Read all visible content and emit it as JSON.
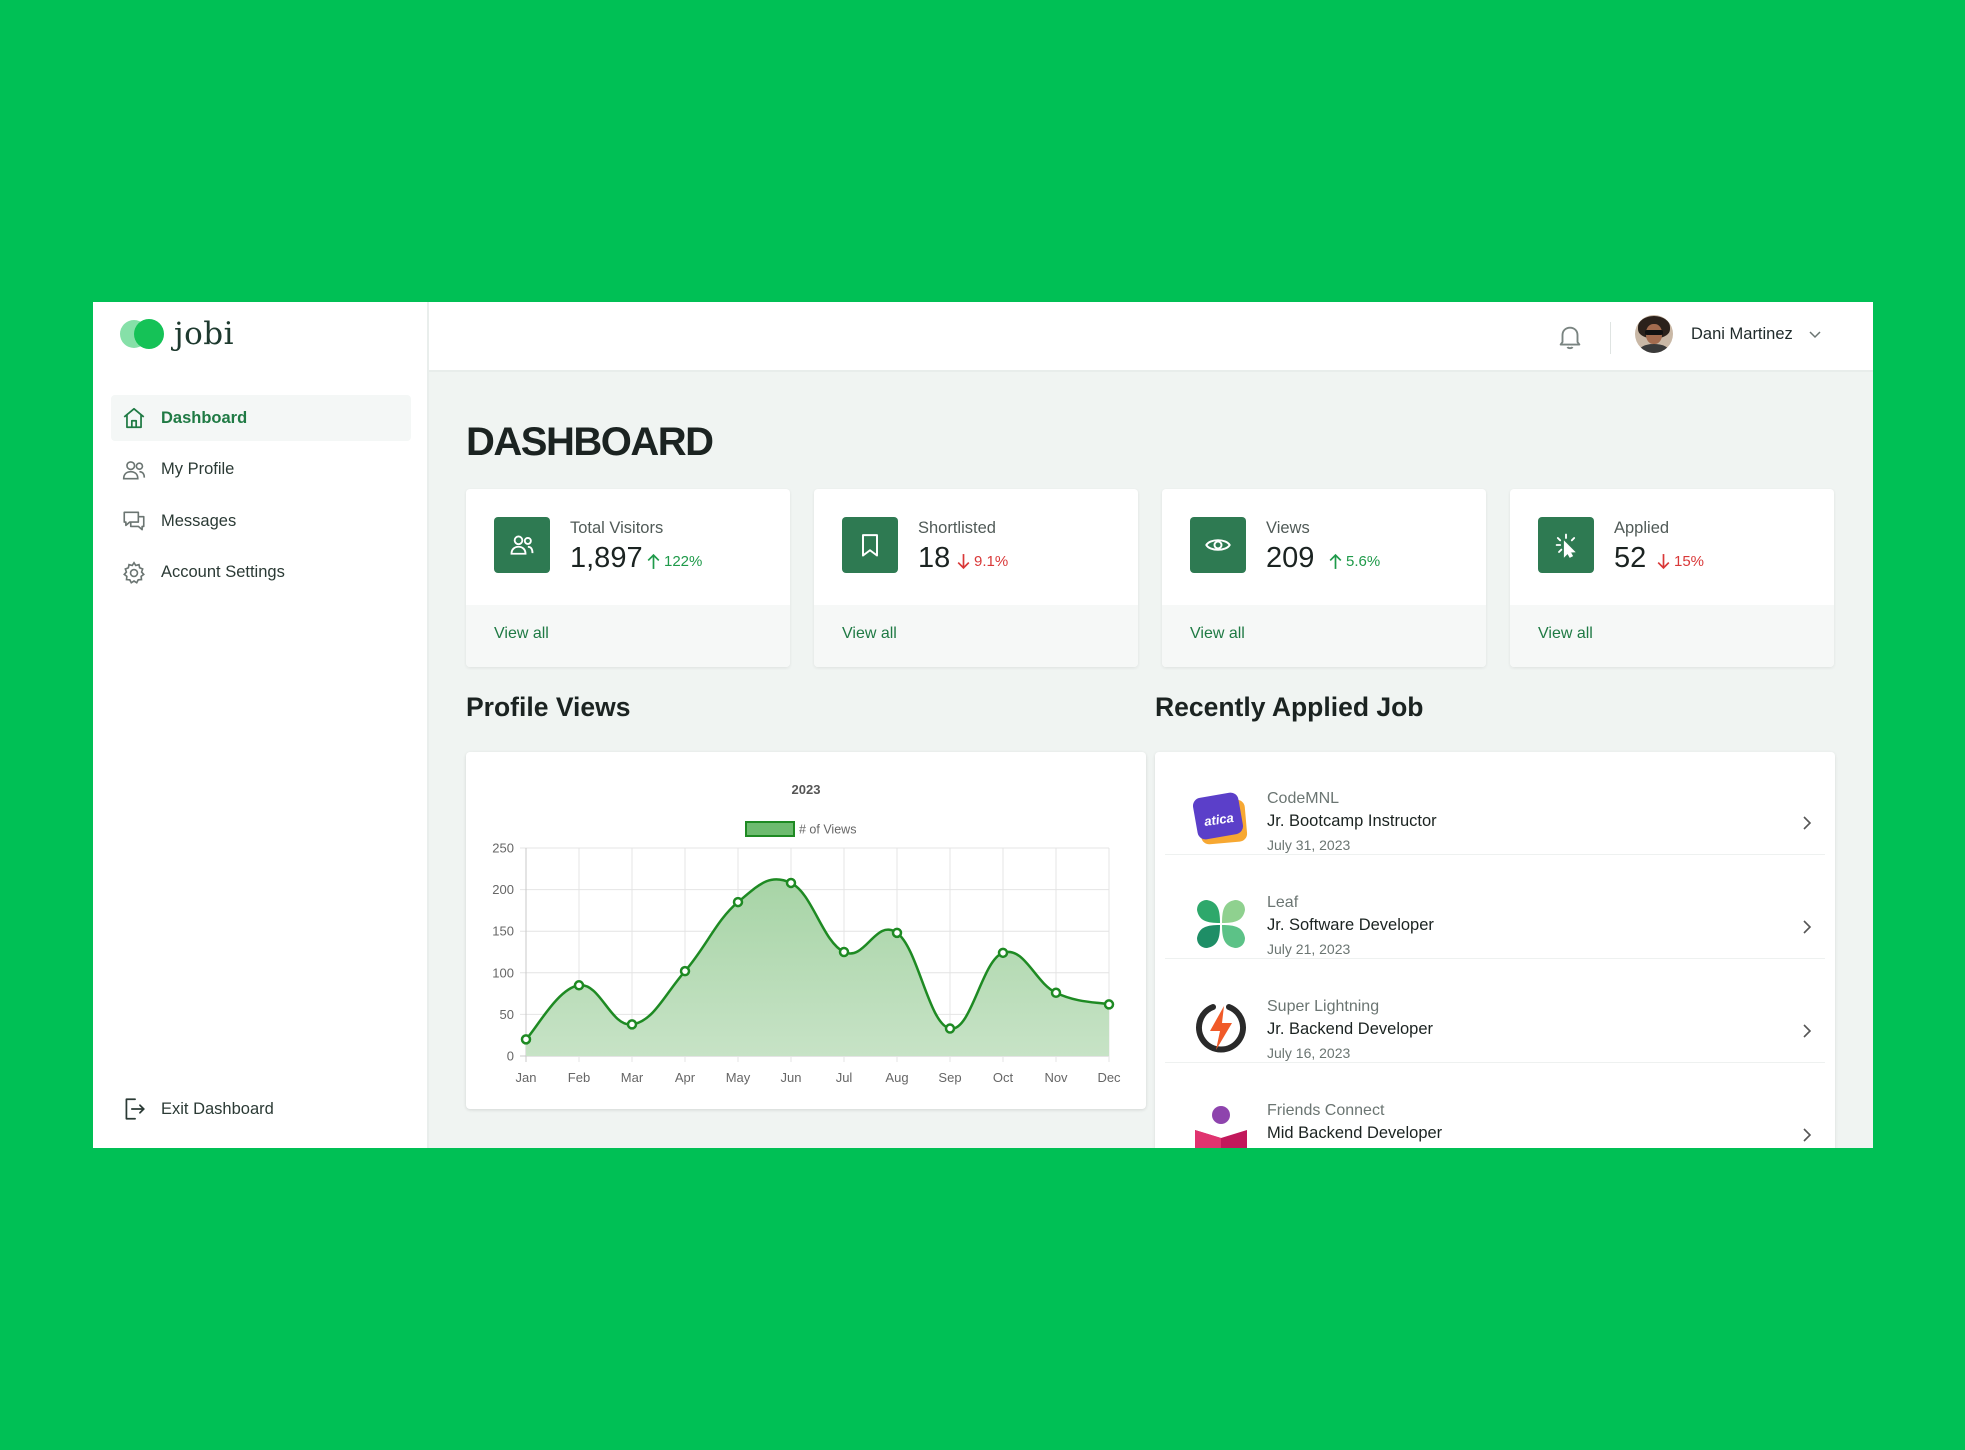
{
  "brand": {
    "name": "jobi"
  },
  "sidebar": {
    "items": [
      {
        "label": "Dashboard",
        "icon": "home-icon",
        "active": true
      },
      {
        "label": "My Profile",
        "icon": "users-icon",
        "active": false
      },
      {
        "label": "Messages",
        "icon": "chat-icon",
        "active": false
      },
      {
        "label": "Account Settings",
        "icon": "gear-icon",
        "active": false
      }
    ],
    "exit_label": "Exit Dashboard"
  },
  "header": {
    "user_name": "Dani Martinez",
    "bell_icon": "bell-icon"
  },
  "page": {
    "title": "DASHBOARD"
  },
  "stats": [
    {
      "label": "Total Visitors",
      "value": "1,897",
      "change": "122%",
      "direction": "up",
      "icon": "users-icon",
      "link": "View all"
    },
    {
      "label": "Shortlisted",
      "value": "18",
      "change": "9.1%",
      "direction": "down",
      "icon": "bookmark-icon",
      "link": "View all"
    },
    {
      "label": "Views",
      "value": "209",
      "change": "5.6%",
      "direction": "up",
      "icon": "eye-icon",
      "link": "View all"
    },
    {
      "label": "Applied",
      "value": "52",
      "change": "15%",
      "direction": "down",
      "icon": "click-icon",
      "link": "View all"
    }
  ],
  "sections": {
    "profile_views": "Profile Views",
    "recent_jobs": "Recently Applied Job"
  },
  "chart_data": {
    "type": "area",
    "title": "2023",
    "categories": [
      "Jan",
      "Feb",
      "Mar",
      "Apr",
      "May",
      "Jun",
      "Jul",
      "Aug",
      "Sep",
      "Oct",
      "Nov",
      "Dec"
    ],
    "series": [
      {
        "name": "# of Views",
        "values": [
          20,
          85,
          38,
          102,
          185,
          208,
          125,
          148,
          33,
          124,
          76,
          62
        ]
      }
    ],
    "ylim": [
      0,
      250
    ],
    "yticks": [
      0,
      50,
      100,
      150,
      200,
      250
    ],
    "grid": true,
    "legend": "top",
    "colors": {
      "line": "#1e8a23",
      "fill": "#c7e3c6",
      "legend_fill": "#6dbb6f"
    }
  },
  "jobs": [
    {
      "company": "CodeMNL",
      "title": "Jr. Bootcamp Instructor",
      "date": "July 31, 2023",
      "logo": "atica",
      "logo_icon": "atica-logo"
    },
    {
      "company": "Leaf",
      "title": "Jr. Software Developer",
      "date": "July 21, 2023",
      "logo_icon": "leaf-logo"
    },
    {
      "company": "Super Lightning",
      "title": "Jr. Backend Developer",
      "date": "July 16, 2023",
      "logo_icon": "lightning-logo"
    },
    {
      "company": "Friends Connect",
      "title": "Mid Backend Developer",
      "date": "",
      "logo_icon": "friends-logo"
    }
  ]
}
